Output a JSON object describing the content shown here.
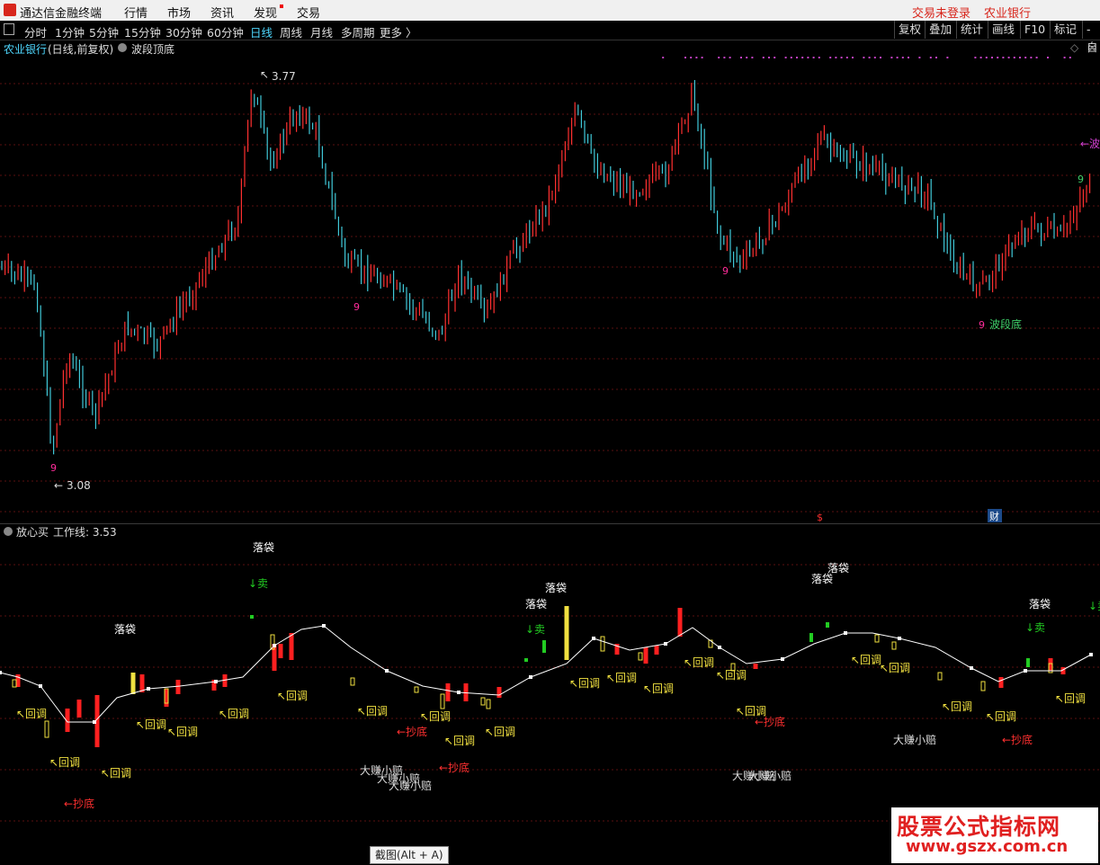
{
  "menubar": {
    "app_title": "通达信金融终端",
    "items": [
      "行情",
      "市场",
      "资讯",
      "发现",
      "交易"
    ],
    "right_login": "交易未登录",
    "right_stock": "农业银行"
  },
  "toolbar": {
    "periods": [
      "分时",
      "1分钟",
      "5分钟",
      "15分钟",
      "30分钟",
      "60分钟",
      "日线",
      "周线",
      "月线",
      "多周期",
      "更多 〉"
    ],
    "active_period": "日线",
    "right_buttons": [
      "复权",
      "叠加",
      "统计",
      "画线",
      "F10",
      "标记",
      "-自"
    ]
  },
  "main_chart": {
    "stock_label": "农业银行",
    "period_label": "(日线,前复权)",
    "indicator": "波段顶底",
    "high_label": "3.77",
    "low_label": "3.08",
    "nine_labels": [
      "9",
      "9",
      "9",
      "9",
      "9"
    ],
    "bottom_label": "波段底",
    "top_label": "←波",
    "markers": [
      "$",
      "财"
    ]
  },
  "sub_chart": {
    "indicator": "放心买",
    "work_line": "工作线: 3.53"
  },
  "annotations": {
    "sell": "↓卖",
    "bag": "落袋",
    "pullback": "↖回调",
    "bottom_fish": "←抄底",
    "earn": "大赚小赔"
  },
  "watermark": {
    "line1": "股票公式指标网",
    "line2": "www.gszx.com.cn"
  },
  "tooltip": "截图(Alt + A)",
  "colors": {
    "up": "#ff3030",
    "down": "#40c8d8",
    "work_line": "#ffffff",
    "bag": "#ffffff",
    "sell": "#22cc22",
    "pullback": "#f0e040",
    "bottom_fish": "#ff3030",
    "nine": "#ff2d9a",
    "magenta": "#c040c0"
  },
  "chart_data": [
    {
      "type": "candlestick",
      "title": "农业银行",
      "price_high": 3.77,
      "price_low": 3.08,
      "ylim": [
        3.0,
        3.8
      ],
      "series": [
        {
          "name": "K线"
        }
      ]
    },
    {
      "type": "line",
      "title": "放心买",
      "series": [
        {
          "name": "工作线",
          "last": 3.53
        }
      ]
    }
  ]
}
